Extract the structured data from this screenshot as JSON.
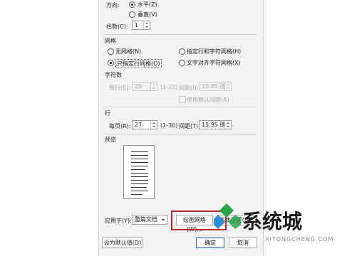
{
  "dialog": {
    "direction_label": "方向:",
    "direction_options": [
      "水平(Z)",
      "垂直(V)"
    ],
    "columns_label": "栏数(C):",
    "columns_value": "1",
    "grid_section_title": "网格",
    "grid_options": [
      "无网格(N)",
      "指定行和字符网格(H)",
      "只指定行网格(O)",
      "文字对齐字符网格(X)"
    ],
    "chars_section_title": "字符数",
    "chars_per_line_label": "每行(E):",
    "chars_per_line_value": "20",
    "chars_range": "(1-22)",
    "chars_pitch_label": "间距(I):",
    "chars_pitch_value": "10.85 磅",
    "use_default_pitch_label": "使用默认间距(A)",
    "lines_section_title": "行",
    "lines_per_page_label": "每页(R):",
    "lines_per_page_value": "27",
    "lines_range": "(1-30)",
    "lines_pitch_label": "间距(T):",
    "lines_pitch_value": "15.95 磅",
    "preview_section_title": "预览",
    "apply_to_label": "应用于(Y):",
    "apply_to_value": "整篇文档",
    "draw_grid_button": "绘图网格(W)...",
    "font_settings_button": "字体设置(F)...",
    "set_default_button": "设为默认值(D)",
    "ok_button": "确定",
    "cancel_button": "取消"
  },
  "watermark": {
    "brand": "系统城",
    "domain": "XITONGCHENG.COM"
  },
  "colors": {
    "highlight": "#c0242c",
    "dialog_bg": "#f3f3f3",
    "primary_border": "#2a6fc9"
  }
}
